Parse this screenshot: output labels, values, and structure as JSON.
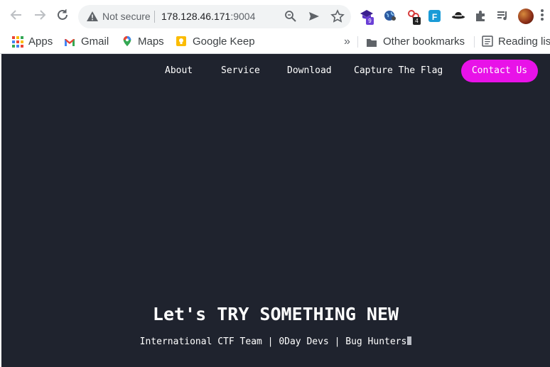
{
  "browser": {
    "security_label": "Not secure",
    "url_host": "178.128.46.171",
    "url_port": ":9004",
    "extension_badges": {
      "ext1": "9",
      "ext3": "4"
    },
    "extension_label_ext4": "F"
  },
  "bookmarks": {
    "apps": "Apps",
    "gmail": "Gmail",
    "maps": "Maps",
    "keep": "Google Keep",
    "overflow": "»",
    "other": "Other bookmarks",
    "reading": "Reading list"
  },
  "site": {
    "nav": [
      "About",
      "Service",
      "Download",
      "Capture The Flag"
    ],
    "contact_label": "Contact Us",
    "hero_title": "Let's TRY SOMETHING NEW",
    "hero_subtitle": "International CTF Team | 0Day Devs | Bug Hunters",
    "colors": {
      "background": "#1f232e",
      "accent": "#e812e8",
      "text": "#ffffff"
    }
  }
}
